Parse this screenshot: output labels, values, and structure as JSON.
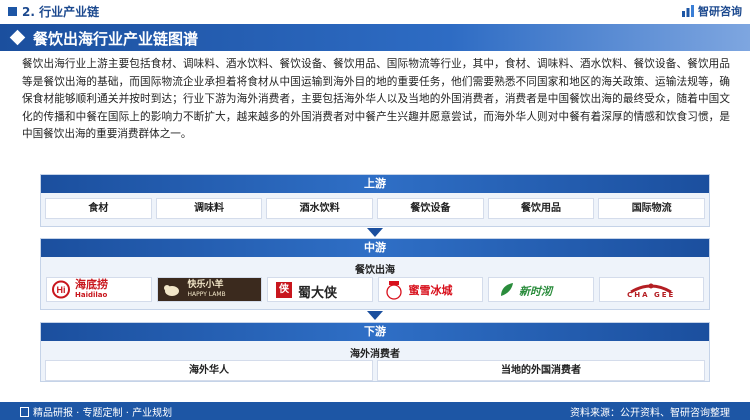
{
  "header": {
    "section_title": "2. 行业产业链",
    "logo_text": "智研咨询"
  },
  "banner": {
    "title": "餐饮出海行业产业链图谱"
  },
  "description": "餐饮出海行业上游主要包括食材、调味料、酒水饮料、餐饮设备、餐饮用品、国际物流等行业，其中，食材、调味料、酒水饮料、餐饮设备、餐饮用品等是餐饮出海的基础，而国际物流企业承担着将食材从中国运输到海外目的地的重要任务，他们需要熟悉不同国家和地区的海关政策、运输法规等，确保食材能够顺利通关并按时到达；行业下游为海外消费者，主要包括海外华人以及当地的外国消费者，消费者是中国餐饮出海的最终受众，随着中国文化的传播和中餐在国际上的影响力不断扩大，越来越多的外国消费者对中餐产生兴趣并愿意尝试，而海外华人则对中餐有着深厚的情感和饮食习惯，是中国餐饮出海的重要消费群体之一。",
  "upstream": {
    "title": "上游",
    "items": [
      "食材",
      "调味料",
      "酒水饮料",
      "餐饮设备",
      "餐饮用品",
      "国际物流"
    ]
  },
  "midstream": {
    "title": "中游",
    "subtitle": "餐饮出海",
    "brands": [
      {
        "cn": "海底捞",
        "en": "Haidilao",
        "icon": "haidilao-logo",
        "color": "#c8161d"
      },
      {
        "cn": "快乐小羊",
        "en": "HAPPY LAMB",
        "icon": "happy-lamb-logo",
        "color": "#3b2a1e"
      },
      {
        "cn": "蜀大侠",
        "en": "",
        "icon": "shudaxia-logo",
        "color": "#c8161d"
      },
      {
        "cn": "蜜雪冰城",
        "en": "",
        "icon": "mixue-logo",
        "color": "#d8101c"
      },
      {
        "cn": "新时沏",
        "en": "",
        "icon": "xinshiqi-logo",
        "color": "#2a8c3c"
      },
      {
        "cn": "CHA GEE",
        "en": "",
        "icon": "chagee-logo",
        "color": "#b41e23"
      }
    ]
  },
  "downstream": {
    "title": "下游",
    "subtitle": "海外消费者",
    "items": [
      "海外华人",
      "当地的外国消费者"
    ]
  },
  "footer": {
    "left": "精品研报 · 专题定制 · 产业规划",
    "right": "资料来源：公开资料、智研咨询整理"
  }
}
